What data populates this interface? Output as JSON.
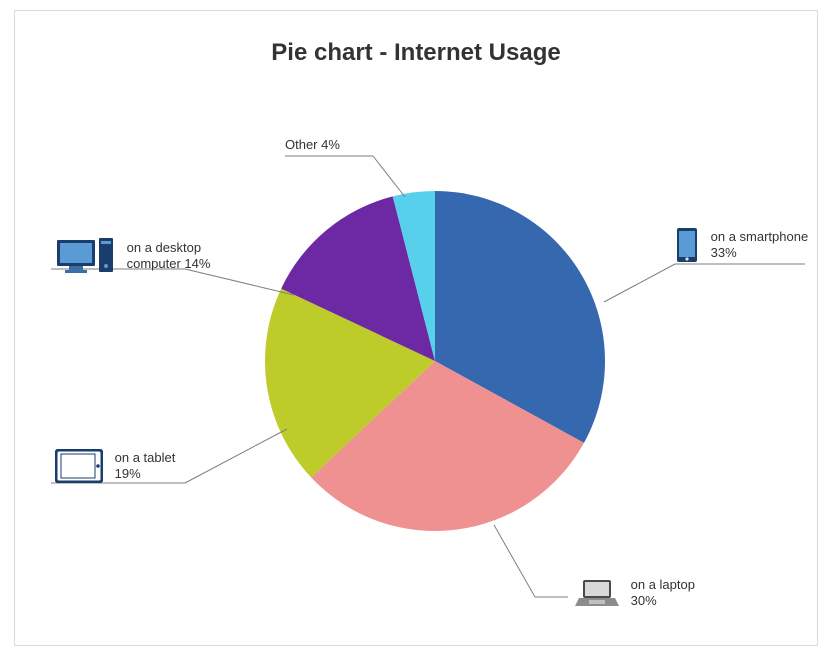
{
  "chart_data": {
    "type": "pie",
    "title": "Pie chart - Internet Usage",
    "series": [
      {
        "name": "on a smartphone",
        "value": 33,
        "color": "#3568AF",
        "label": "on a smartphone 33%",
        "icon": "smartphone"
      },
      {
        "name": "on a laptop",
        "value": 30,
        "color": "#EF9191",
        "label": "on a laptop 30%",
        "icon": "laptop"
      },
      {
        "name": "on a tablet",
        "value": 19,
        "color": "#BDCC2A",
        "label": "on a tablet 19%",
        "icon": "tablet"
      },
      {
        "name": "on a desktop computer",
        "value": 14,
        "color": "#6C29A3",
        "label": "on a desktop computer 14%",
        "icon": "desktop"
      },
      {
        "name": "Other",
        "value": 4,
        "color": "#57D0EB",
        "label": "Other 4%",
        "icon": null
      }
    ]
  },
  "labels": {
    "smartphone": {
      "line1": "on a smartphone",
      "line2": "33%"
    },
    "laptop": {
      "line1": "on a laptop",
      "line2": "30%"
    },
    "tablet": {
      "line1": "on a tablet",
      "line2": "19%"
    },
    "desktop": {
      "line1": "on a desktop",
      "line2": "computer 14%"
    },
    "other": {
      "line1": "Other 4%"
    }
  }
}
